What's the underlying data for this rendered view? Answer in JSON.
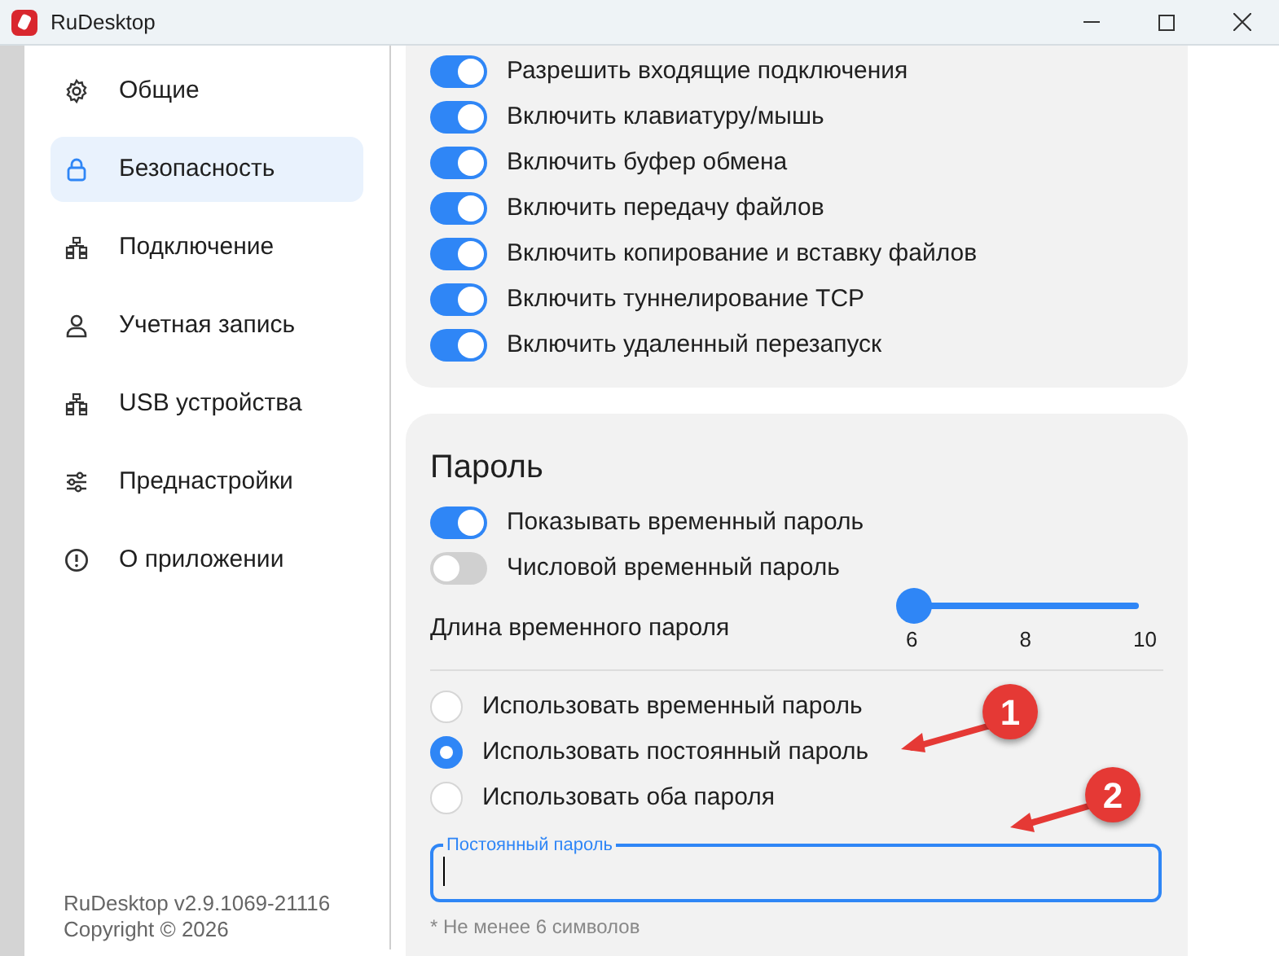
{
  "window": {
    "title": "RuDesktop"
  },
  "sidebar": {
    "items": [
      {
        "label": "Общие",
        "kind": "gear",
        "selected": false
      },
      {
        "label": "Безопасность",
        "kind": "lock",
        "selected": true
      },
      {
        "label": "Подключение",
        "kind": "network",
        "selected": false
      },
      {
        "label": "Учетная запись",
        "kind": "person",
        "selected": false
      },
      {
        "label": "USB устройства",
        "kind": "network",
        "selected": false
      },
      {
        "label": "Преднастройки",
        "kind": "sliders",
        "selected": false
      },
      {
        "label": "О приложении",
        "kind": "info",
        "selected": false
      }
    ],
    "version": "RuDesktop v2.9.1069-21116",
    "copyright": "Copyright © 2026"
  },
  "permissions": [
    {
      "label": "Разрешить входящие подключения",
      "on": true
    },
    {
      "label": "Включить клавиатуру/мышь",
      "on": true
    },
    {
      "label": "Включить буфер обмена",
      "on": true
    },
    {
      "label": "Включить передачу файлов",
      "on": true
    },
    {
      "label": "Включить копирование и вставку файлов",
      "on": true
    },
    {
      "label": "Включить туннелирование TCP",
      "on": true
    },
    {
      "label": "Включить удаленный перезапуск",
      "on": true
    }
  ],
  "password": {
    "title": "Пароль",
    "toggles": [
      {
        "label": "Показывать временный пароль",
        "on": true
      },
      {
        "label": "Числовой временный пароль",
        "on": false
      }
    ],
    "length": {
      "label": "Длина временного пароля",
      "level": 0,
      "ticks": [
        "6",
        "8",
        "10"
      ]
    },
    "modes": [
      {
        "label": "Использовать временный пароль",
        "selected": false
      },
      {
        "label": "Использовать постоянный пароль",
        "selected": true
      },
      {
        "label": "Использовать оба пароля",
        "selected": false
      }
    ],
    "field": {
      "label": "Постоянный пароль"
    },
    "hint": "* Не менее 6 символов"
  },
  "annotations": [
    {
      "label": "1"
    },
    {
      "label": "2"
    }
  ]
}
